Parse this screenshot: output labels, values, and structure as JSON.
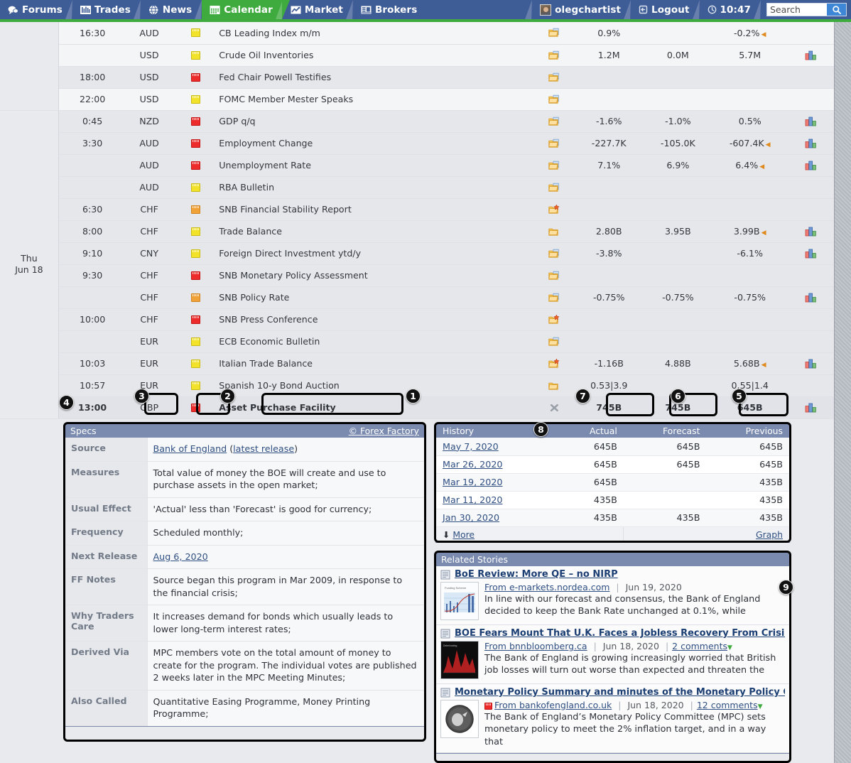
{
  "nav": {
    "left_items": [
      {
        "label": "Forums",
        "icon": "speech-bubble-icon",
        "active": false
      },
      {
        "label": "Trades",
        "icon": "bar-chart-icon",
        "active": false
      },
      {
        "label": "News",
        "icon": "globe-icon",
        "active": false
      },
      {
        "label": "Calendar",
        "icon": "calendar-icon",
        "active": true
      },
      {
        "label": "Market",
        "icon": "line-chart-icon",
        "active": false
      },
      {
        "label": "Brokers",
        "icon": "building-icon",
        "active": false
      }
    ],
    "username": "olegchartist",
    "logout_label": "Logout",
    "clock": "10:47",
    "search_placeholder": "Search",
    "search_value": "",
    "accent_green": "#3fab3f",
    "nav_blue": "#3e5c96"
  },
  "calendar": {
    "rows": [
      {
        "day": "",
        "time": "16:30",
        "currency": "AUD",
        "impact": "low",
        "event": "CB Leading Index m/m",
        "detail": "folder-page",
        "actual": "0.9%",
        "actual_tone": "norm",
        "forecast": "",
        "previous": "-0.2%",
        "previous_tone": "pos",
        "revision": "dn",
        "graph": false,
        "band": "a"
      },
      {
        "day": "",
        "time": "",
        "currency": "USD",
        "impact": "low",
        "event": "Crude Oil Inventories",
        "detail": "folder-page",
        "actual": "1.2M",
        "actual_tone": "neg",
        "forecast": "0.0M",
        "previous": "5.7M",
        "previous_tone": "norm",
        "revision": "",
        "graph": true,
        "band": "a"
      },
      {
        "day": "",
        "time": "18:00",
        "currency": "USD",
        "impact": "high",
        "event": "Fed Chair Powell Testifies",
        "detail": "folder-page",
        "actual": "",
        "actual_tone": "norm",
        "forecast": "",
        "previous": "",
        "previous_tone": "norm",
        "revision": "",
        "graph": false,
        "band": "b"
      },
      {
        "day": "",
        "time": "22:00",
        "currency": "USD",
        "impact": "low",
        "event": "FOMC Member Mester Speaks",
        "detail": "folder-page",
        "actual": "",
        "actual_tone": "norm",
        "forecast": "",
        "previous": "",
        "previous_tone": "norm",
        "revision": "",
        "graph": false,
        "band": "a"
      },
      {
        "day": "Thu\nJun 18",
        "time": "0:45",
        "currency": "NZD",
        "impact": "high",
        "event": "GDP q/q",
        "detail": "folder-page",
        "actual": "-1.6%",
        "actual_tone": "neg",
        "forecast": "-1.0%",
        "previous": "0.5%",
        "previous_tone": "norm",
        "revision": "",
        "graph": true,
        "band": "b"
      },
      {
        "day": "",
        "time": "3:30",
        "currency": "AUD",
        "impact": "high",
        "event": "Employment Change",
        "detail": "folder-page",
        "actual": "-227.7K",
        "actual_tone": "neg",
        "forecast": "-105.0K",
        "previous": "-607.4K",
        "previous_tone": "neg",
        "revision": "dn",
        "graph": true,
        "band": "b"
      },
      {
        "day": "",
        "time": "",
        "currency": "AUD",
        "impact": "high",
        "event": "Unemployment Rate",
        "detail": "folder-page",
        "actual": "7.1%",
        "actual_tone": "neg",
        "forecast": "6.9%",
        "previous": "6.4%",
        "previous_tone": "neg",
        "revision": "dn",
        "graph": true,
        "band": "b"
      },
      {
        "day": "",
        "time": "",
        "currency": "AUD",
        "impact": "low",
        "event": "RBA Bulletin",
        "detail": "folder-page",
        "actual": "",
        "actual_tone": "norm",
        "forecast": "",
        "previous": "",
        "previous_tone": "norm",
        "revision": "",
        "graph": false,
        "band": "b"
      },
      {
        "day": "",
        "time": "6:30",
        "currency": "CHF",
        "impact": "med",
        "event": "SNB Financial Stability Report",
        "detail": "folder-star",
        "actual": "",
        "actual_tone": "norm",
        "forecast": "",
        "previous": "",
        "previous_tone": "norm",
        "revision": "",
        "graph": false,
        "band": "b"
      },
      {
        "day": "",
        "time": "8:00",
        "currency": "CHF",
        "impact": "low",
        "event": "Trade Balance",
        "detail": "folder-plain",
        "actual": "2.80B",
        "actual_tone": "neg",
        "forecast": "3.95B",
        "previous": "3.99B",
        "previous_tone": "neg",
        "revision": "dn",
        "graph": true,
        "band": "b"
      },
      {
        "day": "",
        "time": "9:10",
        "currency": "CNY",
        "impact": "low",
        "event": "Foreign Direct Investment ytd/y",
        "detail": "folder-page",
        "actual": "-3.8%",
        "actual_tone": "norm",
        "forecast": "",
        "previous": "-6.1%",
        "previous_tone": "norm",
        "revision": "",
        "graph": true,
        "band": "b"
      },
      {
        "day": "",
        "time": "9:30",
        "currency": "CHF",
        "impact": "high",
        "event": "SNB Monetary Policy Assessment",
        "detail": "folder-page",
        "actual": "",
        "actual_tone": "norm",
        "forecast": "",
        "previous": "",
        "previous_tone": "norm",
        "revision": "",
        "graph": false,
        "band": "b"
      },
      {
        "day": "",
        "time": "",
        "currency": "CHF",
        "impact": "med",
        "event": "SNB Policy Rate",
        "detail": "folder-page",
        "actual": "-0.75%",
        "actual_tone": "norm",
        "forecast": "-0.75%",
        "previous": "-0.75%",
        "previous_tone": "norm",
        "revision": "",
        "graph": true,
        "band": "b"
      },
      {
        "day": "",
        "time": "10:00",
        "currency": "CHF",
        "impact": "high",
        "event": "SNB Press Conference",
        "detail": "folder-star",
        "actual": "",
        "actual_tone": "norm",
        "forecast": "",
        "previous": "",
        "previous_tone": "norm",
        "revision": "",
        "graph": false,
        "band": "b"
      },
      {
        "day": "",
        "time": "",
        "currency": "EUR",
        "impact": "low",
        "event": "ECB Economic Bulletin",
        "detail": "folder-page",
        "actual": "",
        "actual_tone": "norm",
        "forecast": "",
        "previous": "",
        "previous_tone": "norm",
        "revision": "",
        "graph": false,
        "band": "b"
      },
      {
        "day": "",
        "time": "10:03",
        "currency": "EUR",
        "impact": "low",
        "event": "Italian Trade Balance",
        "detail": "folder-star",
        "actual": "-1.16B",
        "actual_tone": "neg",
        "forecast": "4.88B",
        "previous": "5.68B",
        "previous_tone": "norm",
        "revision": "dn",
        "graph": true,
        "band": "b"
      },
      {
        "day": "",
        "time": "10:57",
        "currency": "EUR",
        "impact": "low",
        "event": "Spanish 10-y Bond Auction",
        "detail": "folder-plain",
        "actual": "0.53|3.9",
        "actual_tone": "norm",
        "forecast": "",
        "previous": "0.55|1.4",
        "previous_tone": "norm",
        "revision": "",
        "graph": false,
        "band": "b"
      },
      {
        "day": "",
        "time": "13:00",
        "time_bold": true,
        "currency": "GBP",
        "impact": "high",
        "event": "Asset Purchase Facility",
        "detail": "cross",
        "actual": "745B",
        "actual_tone": "norm",
        "forecast": "745B",
        "previous": "645B",
        "previous_tone": "norm",
        "revision": "",
        "graph": true,
        "band": "hi"
      }
    ]
  },
  "specs": {
    "header_title": "Specs",
    "header_link": "© Forex Factory",
    "rows": [
      {
        "key": "Source",
        "value": "Bank of England (latest release)",
        "link_main": "Bank of England",
        "link_sub": "latest release"
      },
      {
        "key": "Measures",
        "value": "Total value of money the BOE will create and use to purchase assets in the open market;"
      },
      {
        "key": "Usual Effect",
        "value": "'Actual' less than 'Forecast' is good for currency;"
      },
      {
        "key": "Frequency",
        "value": "Scheduled monthly;"
      },
      {
        "key": "Next Release",
        "value": "Aug 6, 2020",
        "is_link": true
      },
      {
        "key": "FF Notes",
        "value": "Source began this program in Mar 2009, in response to the financial crisis;"
      },
      {
        "key": "Why Traders Care",
        "value": "It increases demand for bonds which usually leads to lower long-term interest rates;"
      },
      {
        "key": "Derived Via",
        "value": "MPC members vote on the total amount of money to create for the program. The individual votes are published 2 weeks later in the MPC Meeting Minutes;"
      },
      {
        "key": "Also Called",
        "value": "Quantitative Easing Programme, Money Printing Programme;"
      }
    ]
  },
  "history": {
    "header_title": "History",
    "columns": [
      "Actual",
      "Forecast",
      "Previous"
    ],
    "rows": [
      {
        "date": "May 7, 2020",
        "actual": "645B",
        "forecast": "645B",
        "previous": "645B"
      },
      {
        "date": "Mar 26, 2020",
        "actual": "645B",
        "forecast": "645B",
        "previous": "645B"
      },
      {
        "date": "Mar 19, 2020",
        "actual": "645B",
        "forecast": "",
        "previous": "435B"
      },
      {
        "date": "Mar 11, 2020",
        "actual": "435B",
        "forecast": "",
        "previous": "435B"
      },
      {
        "date": "Jan 30, 2020",
        "actual": "435B",
        "forecast": "435B",
        "previous": "435B"
      }
    ],
    "more_label": "More",
    "graph_label": "Graph"
  },
  "stories": {
    "header_title": "Related Stories",
    "items": [
      {
        "title": "BoE Review: More QE – no NIRP",
        "source": "From e-markets.nordea.com",
        "date": "Jun 19, 2020",
        "comments": "",
        "excerpt": "In line with our forecast and consensus, the Bank of England decided to keep the Bank Rate unchanged at 0.1%, while",
        "thumb": "line-chart-thumb",
        "has_flag": false
      },
      {
        "title": "BOE Fears Mount That U.K. Faces a Jobless Recovery From Crisis",
        "source": "From bnnbloomberg.ca",
        "date": "Jun 18, 2020",
        "comments": "2 comments",
        "excerpt": "The Bank of England is growing increasingly worried that British job losses will turn out worse than expected and threaten the",
        "thumb": "dark-histogram-thumb",
        "has_flag": false
      },
      {
        "title": "Monetary Policy Summary and minutes of the Monetary Policy Com",
        "source": "From bankofengland.co.uk",
        "date": "Jun 18, 2020",
        "comments": "12 comments",
        "excerpt": "The Bank of England’s Monetary Policy Committee (MPC) sets monetary policy to meet the 2% inflation target, and in a way that",
        "thumb": "boe-seal-thumb",
        "has_flag": true
      }
    ]
  },
  "annotations": [
    {
      "num": "1",
      "target": "event-name-cell"
    },
    {
      "num": "2",
      "target": "impact-icon-cell"
    },
    {
      "num": "3",
      "target": "currency-cell"
    },
    {
      "num": "4",
      "target": "specs-panel"
    },
    {
      "num": "5",
      "target": "previous-value-cell"
    },
    {
      "num": "6",
      "target": "forecast-value-cell"
    },
    {
      "num": "7",
      "target": "actual-value-cell"
    },
    {
      "num": "8",
      "target": "history-panel"
    },
    {
      "num": "9",
      "target": "related-stories-panel"
    }
  ]
}
